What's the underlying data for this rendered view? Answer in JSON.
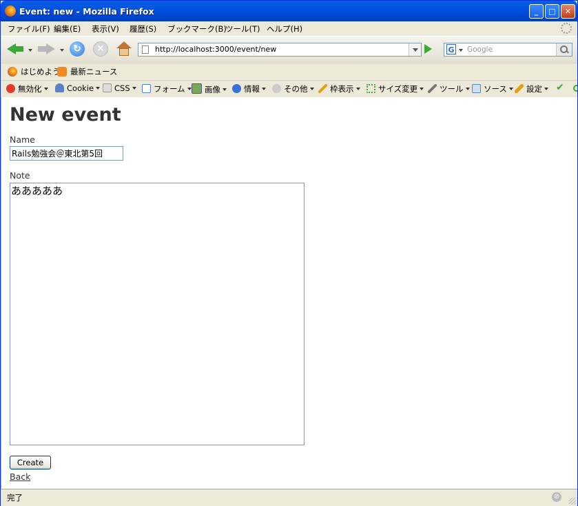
{
  "window": {
    "title": "Event: new - Mozilla Firefox"
  },
  "menu": [
    "ファイル(F)",
    "編集(E)",
    "表示(V)",
    "履歴(S)",
    "ブックマーク(B)",
    "ツール(T)",
    "ヘルプ(H)"
  ],
  "nav": {
    "url": "http://localhost:3000/event/new",
    "search_placeholder": "Google",
    "search_engine": "G"
  },
  "bookmarks": [
    "はじめよう",
    "最新ニュース"
  ],
  "devtools": [
    "無効化",
    "Cookie",
    "CSS",
    "フォーム",
    "画像",
    "情報",
    "その他",
    "枠表示",
    "サイズ変更",
    "ツール",
    "ソース",
    "設定"
  ],
  "page": {
    "heading": "New event",
    "name_label": "Name",
    "name_value": "Rails勉強会＠東北第5回",
    "note_label": "Note",
    "note_value": "あああああ",
    "create_label": "Create",
    "back_label": "Back"
  },
  "status": {
    "text": "完了"
  }
}
